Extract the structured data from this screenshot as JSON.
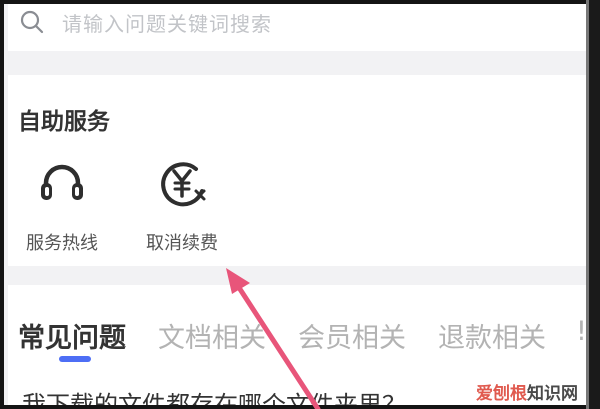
{
  "search": {
    "placeholder": "请输入问题关键词搜索"
  },
  "self_service": {
    "title": "自助服务",
    "items": [
      {
        "label": "服务热线",
        "icon": "headset-icon"
      },
      {
        "label": "取消续费",
        "icon": "yuan-cancel-icon"
      }
    ]
  },
  "faq": {
    "tabs": [
      {
        "label": "常见问题",
        "active": true
      },
      {
        "label": "文档相关",
        "active": false
      },
      {
        "label": "会员相关",
        "active": false
      },
      {
        "label": "退款相关",
        "active": false
      },
      {
        "label": "!",
        "active": false
      }
    ],
    "first_question": "我下载的文件都存在哪个文件夹里？"
  },
  "watermark": {
    "part1": "爱刨根",
    "part2": "知识网"
  },
  "colors": {
    "accent": "#4d6ef5",
    "annotation_arrow": "#e8557a",
    "page_background": "#f2f2f4"
  }
}
